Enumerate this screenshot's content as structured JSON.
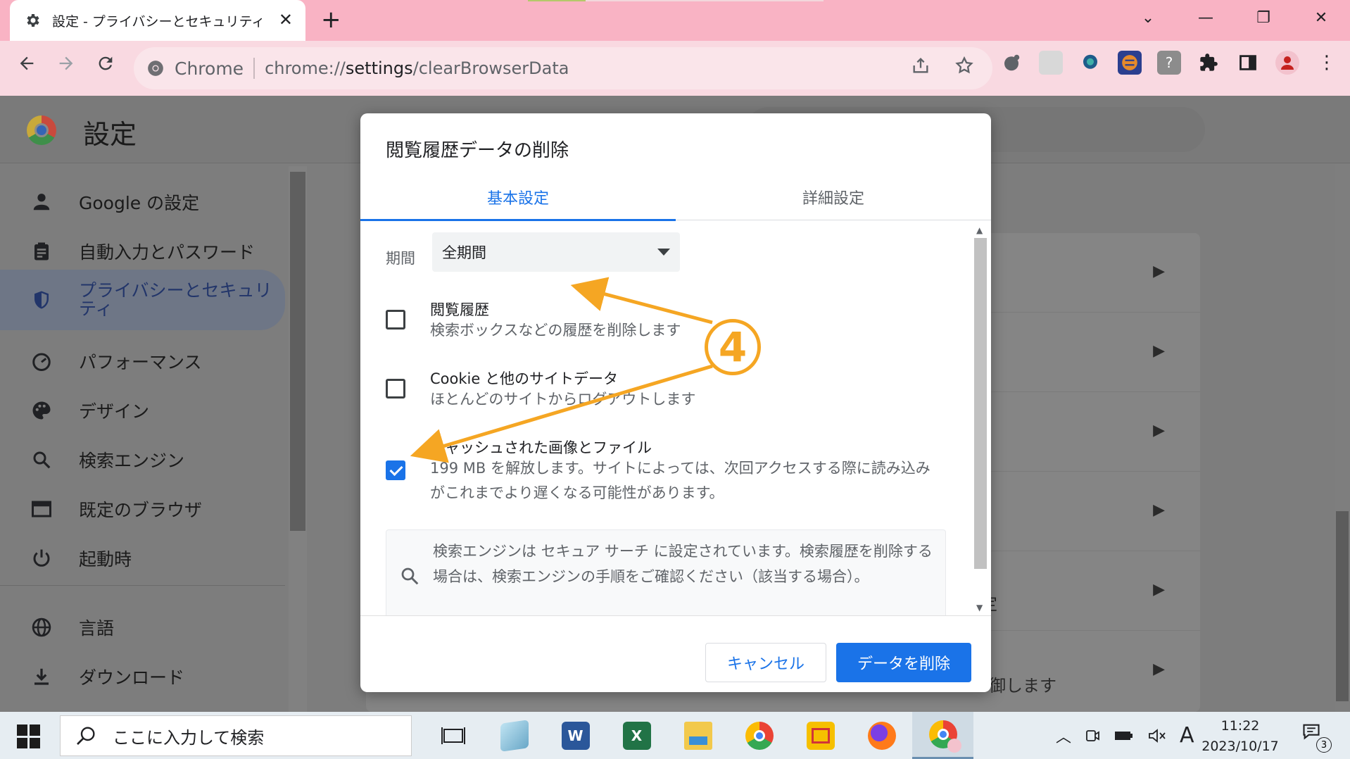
{
  "window": {
    "tab_title": "設定 - プライバシーとセキュリティ",
    "new_tab": "+",
    "close_tab": "✕",
    "minimize": "—",
    "restore": "❐",
    "close": "✕",
    "tab_search": "⌄"
  },
  "omnibox": {
    "site_label": "Chrome",
    "url_scheme": "chrome://",
    "url_host": "settings",
    "url_path": "/clearBrowserData"
  },
  "settings_page": {
    "title": "設定",
    "sidebar": [
      {
        "label": "Google の設定",
        "icon": "person-icon"
      },
      {
        "label": "自動入力とパスワード",
        "icon": "clipboard-icon"
      },
      {
        "label": "プライバシーとセキュリティ",
        "icon": "shield-icon",
        "active": true
      },
      {
        "label": "パフォーマンス",
        "icon": "speedometer-icon"
      },
      {
        "label": "デザイン",
        "icon": "palette-icon"
      },
      {
        "label": "検索エンジン",
        "icon": "search-icon"
      },
      {
        "label": "既定のブラウザ",
        "icon": "browser-window-icon"
      },
      {
        "label": "起動時",
        "icon": "power-icon"
      },
      {
        "label": "言語",
        "icon": "globe-icon"
      },
      {
        "label": "ダウンロード",
        "icon": "download-icon"
      }
    ],
    "fragment_1": "定",
    "fragment_2": "御します"
  },
  "dialog": {
    "title": "閲覧履歴データの削除",
    "tab_basic": "基本設定",
    "tab_advanced": "詳細設定",
    "period_label": "期間",
    "period_value": "全期間",
    "options": [
      {
        "title": "閲覧履歴",
        "desc": "検索ボックスなどの履歴を削除します",
        "checked": false
      },
      {
        "title": "Cookie と他のサイトデータ",
        "desc": "ほとんどのサイトからログアウトします",
        "checked": false
      },
      {
        "title": "キャッシュされた画像とファイル",
        "desc": "199 MB を解放します。サイトによっては、次回アクセスする際に読み込みがこれまでより遅くなる可能性があります。",
        "checked": true
      }
    ],
    "info_text": "検索エンジンは セキュア サーチ に設定されています。検索履歴を削除する場合は、検索エンジンの手順をご確認ください（該当する場合）。",
    "cancel_label": "キャンセル",
    "delete_label": "データを削除"
  },
  "annotation": {
    "step": "4",
    "color": "#f5a623"
  },
  "taskbar": {
    "search_placeholder": "ここに入力して検索",
    "ime": "A",
    "time": "11:22",
    "date": "2023/10/17",
    "notification_count": "3",
    "apps": [
      {
        "name": "task-view-icon"
      },
      {
        "name": "notepad-icon"
      },
      {
        "name": "word-icon",
        "letter": "W"
      },
      {
        "name": "excel-icon",
        "letter": "X"
      },
      {
        "name": "file-explorer-icon"
      },
      {
        "name": "chrome-icon"
      },
      {
        "name": "sticky-app-icon"
      },
      {
        "name": "firefox-icon"
      },
      {
        "name": "chrome-profile-icon"
      }
    ]
  }
}
